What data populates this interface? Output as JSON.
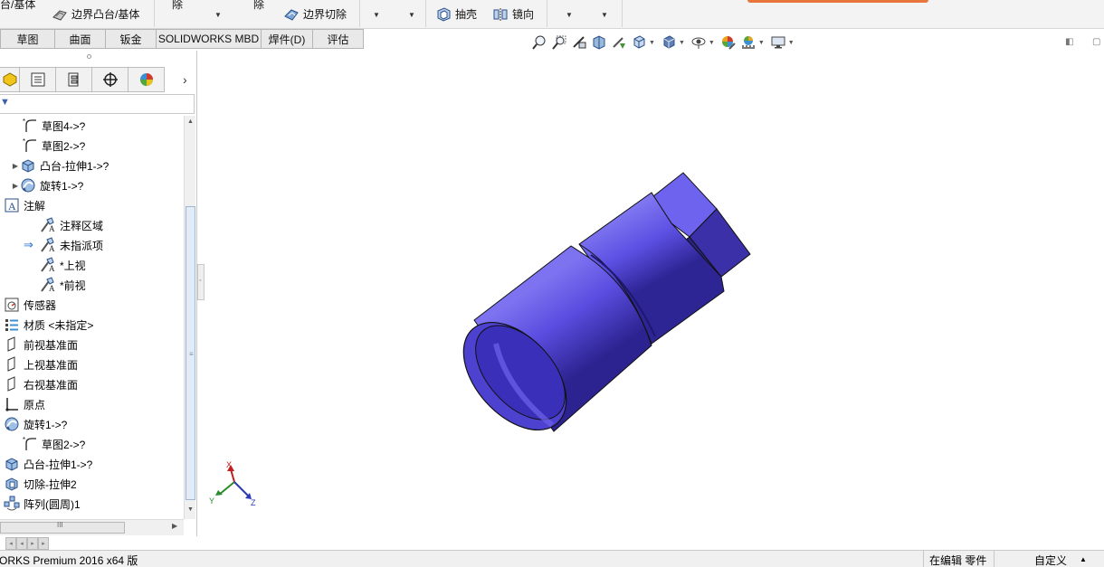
{
  "ribbon": {
    "partial_top_left": "台/基体",
    "boundary_boss": "边界凸台/基体",
    "partial_cut_1": "除",
    "partial_cut_2": "除",
    "boundary_cut": "边界切除",
    "shell": "抽壳",
    "mirror": "镜向"
  },
  "tabs": [
    "草图",
    "曲面",
    "钣金",
    "SOLIDWORKS MBD",
    "焊件(D)",
    "评估"
  ],
  "tree": {
    "items": [
      {
        "label": "草图4->?",
        "icon": "sketch-icon",
        "indent": 1
      },
      {
        "label": "草图2->?",
        "icon": "sketch-icon",
        "indent": 1
      },
      {
        "label": "凸台-拉伸1->?",
        "icon": "extrude-icon",
        "indent": 1,
        "expandable": true
      },
      {
        "label": "旋转1->?",
        "icon": "revolve-icon",
        "indent": 1,
        "expandable": true
      },
      {
        "label": "注解",
        "icon": "annotation-icon",
        "indent": 0
      },
      {
        "label": "注释区域",
        "icon": "annotation-view-icon",
        "indent": 2
      },
      {
        "label": "未指派项",
        "icon": "annotation-view-icon",
        "indent": 2,
        "arrow": true
      },
      {
        "label": "*上视",
        "icon": "annotation-view-icon",
        "indent": 2
      },
      {
        "label": "*前视",
        "icon": "annotation-view-icon",
        "indent": 2
      },
      {
        "label": "传感器",
        "icon": "sensor-icon",
        "indent": 0
      },
      {
        "label": "材质 <未指定>",
        "icon": "material-icon",
        "indent": 0
      },
      {
        "label": "前视基准面",
        "icon": "plane-icon",
        "indent": 0
      },
      {
        "label": "上视基准面",
        "icon": "plane-icon",
        "indent": 0
      },
      {
        "label": "右视基准面",
        "icon": "plane-icon",
        "indent": 0
      },
      {
        "label": "原点",
        "icon": "origin-icon",
        "indent": 0
      },
      {
        "label": "旋转1->?",
        "icon": "revolve-icon",
        "indent": 0
      },
      {
        "label": "草图2->?",
        "icon": "sketch-icon",
        "indent": 1
      },
      {
        "label": "凸台-拉伸1->?",
        "icon": "extrude-icon",
        "indent": 0
      },
      {
        "label": "切除-拉伸2",
        "icon": "cut-extrude-icon",
        "indent": 0
      },
      {
        "label": "阵列(圆周)1",
        "icon": "circular-pattern-icon",
        "indent": 0
      }
    ]
  },
  "triad": {
    "x": "X",
    "y": "Y",
    "z": "Z"
  },
  "status": {
    "product": "ORKS Premium 2016 x64 版",
    "mode": "在编辑 零件",
    "custom": "自定义"
  },
  "colors": {
    "part_fill": "#5a4de0",
    "part_dark": "#2c2390",
    "part_light": "#7d73f0",
    "accent": "#e8763a"
  }
}
